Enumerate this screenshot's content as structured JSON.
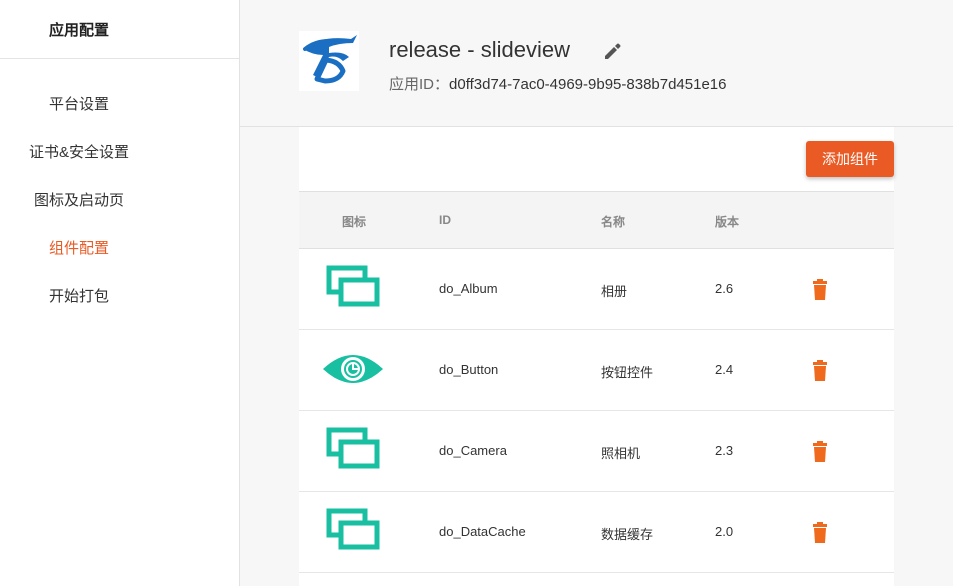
{
  "sidebar": {
    "title": "应用配置",
    "items": [
      {
        "label": "平台设置",
        "active": false
      },
      {
        "label": "证书&安全设置",
        "active": false
      },
      {
        "label": "图标及启动页",
        "active": false
      },
      {
        "label": "组件配置",
        "active": true
      },
      {
        "label": "开始打包",
        "active": false
      }
    ]
  },
  "header": {
    "app_name": "release - slideview",
    "app_id_label": "应用ID：",
    "app_id": "d0ff3d74-7ac0-4969-9b95-838b7d451e16",
    "edit_icon": "pencil-icon",
    "logo_icon": "deviceone-logo"
  },
  "toolbar": {
    "add_component_label": "添加组件"
  },
  "table": {
    "columns": [
      "图标",
      "ID",
      "名称",
      "版本"
    ],
    "rows": [
      {
        "icon": "windows-icon",
        "id": "do_Album",
        "name": "相册",
        "version": "2.6",
        "action_icon": "trash-icon"
      },
      {
        "icon": "eye-icon",
        "id": "do_Button",
        "name": "按钮控件",
        "version": "2.4",
        "action_icon": "trash-icon"
      },
      {
        "icon": "windows-icon",
        "id": "do_Camera",
        "name": "照相机",
        "version": "2.3",
        "action_icon": "trash-icon"
      },
      {
        "icon": "windows-icon",
        "id": "do_DataCache",
        "name": "数据缓存",
        "version": "2.0",
        "action_icon": "trash-icon"
      }
    ]
  },
  "colors": {
    "accent": "#e95a24",
    "icon_teal": "#18bfa0",
    "logo_blue": "#1b6fc2",
    "trash": "#f06a1d"
  }
}
